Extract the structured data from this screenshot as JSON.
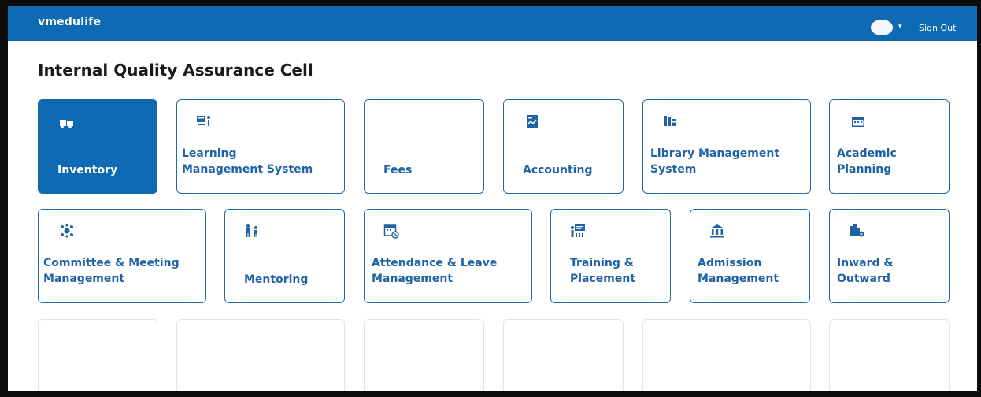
{
  "header": {
    "brand": "vmedulife",
    "sign_out": "Sign Out",
    "caret": "▾"
  },
  "page": {
    "title": "Internal Quality Assurance Cell"
  },
  "modules": [
    {
      "label": "Inventory",
      "icon": "inventory-icon",
      "active": true
    },
    {
      "label": "Learning\nManagement System",
      "icon": "lms-icon"
    },
    {
      "label": "Fees",
      "icon": ""
    },
    {
      "label": "Accounting",
      "icon": "accounting-icon"
    },
    {
      "label": "Library Management\nSystem",
      "icon": "library-icon"
    },
    {
      "label": "Academic\nPlanning",
      "icon": "calendar-icon"
    },
    {
      "label": "Committee & Meeting\nManagement",
      "icon": "committee-icon"
    },
    {
      "label": "Mentoring",
      "icon": "mentoring-icon"
    },
    {
      "label": "Attendance & Leave\nManagement",
      "icon": "attendance-icon"
    },
    {
      "label": "Training &\nPlacement",
      "icon": "training-icon"
    },
    {
      "label": "Admission\nManagement",
      "icon": "admission-icon"
    },
    {
      "label": "Inward &\nOutward",
      "icon": "inward-outward-icon"
    }
  ],
  "colors": {
    "primary": "#0e6ab2",
    "tile_border": "#1d6aa9",
    "tile_text": "#1f63a4"
  }
}
